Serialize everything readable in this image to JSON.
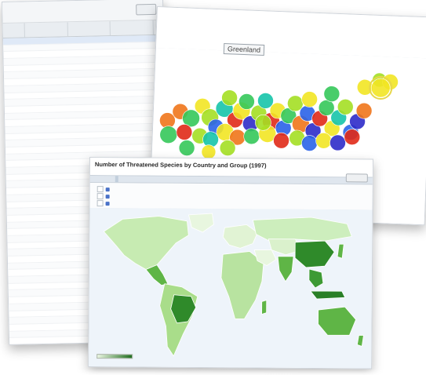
{
  "bubble_view": {
    "tooltip": "Greenland",
    "colors": {
      "red": "#e02a18",
      "orange": "#f0761b",
      "yellow": "#f2e524",
      "lime": "#a4df24",
      "green": "#35c85a",
      "teal": "#16c4aa",
      "blue": "#2a63e8",
      "navy": "#2d2bc9"
    }
  },
  "map_view": {
    "title": "Number of Threatened Species by Country and Group (1997)",
    "colors": {
      "ocean": "#eef4fa",
      "low": "#e8f6df",
      "mid": "#8fd36a",
      "high": "#1f6d1e"
    }
  }
}
